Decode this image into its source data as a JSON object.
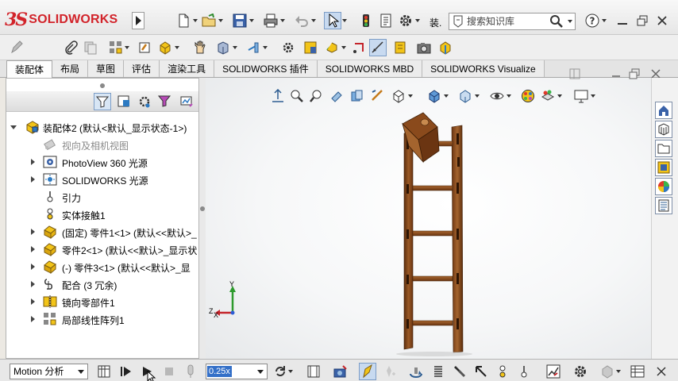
{
  "app": {
    "logo_mark": "3S",
    "logo_word": "SOLIDWORKS",
    "title_fragment": "装."
  },
  "search": {
    "placeholder": "搜索知识库"
  },
  "tabs": [
    {
      "label": "装配体",
      "active": true
    },
    {
      "label": "布局"
    },
    {
      "label": "草图"
    },
    {
      "label": "评估"
    },
    {
      "label": "渲染工具"
    },
    {
      "label": "SOLIDWORKS 插件"
    },
    {
      "label": "SOLIDWORKS MBD"
    },
    {
      "label": "SOLIDWORKS Visualize"
    }
  ],
  "tree": {
    "items": [
      {
        "label": "装配体2  (默认<默认_显示状态-1>)",
        "icon": "assembly-icon",
        "twisty": "open"
      },
      {
        "label": "视向及相机视图",
        "icon": "camera-icon",
        "twisty": "none",
        "grey": true
      },
      {
        "label": "PhotoView 360 光源",
        "icon": "photoview-icon",
        "twisty": "closed"
      },
      {
        "label": "SOLIDWORKS 光源",
        "icon": "lights-icon",
        "twisty": "closed"
      },
      {
        "label": "引力",
        "icon": "gravity-icon",
        "twisty": "none"
      },
      {
        "label": "实体接触1",
        "icon": "contact-icon",
        "twisty": "none"
      },
      {
        "label": "(固定) 零件1<1> (默认<<默认>_",
        "icon": "part-icon",
        "twisty": "closed"
      },
      {
        "label": "零件2<1> (默认<<默认>_显示状",
        "icon": "part-icon",
        "twisty": "closed"
      },
      {
        "label": "(-) 零件3<1> (默认<<默认>_显",
        "icon": "part-icon",
        "twisty": "closed"
      },
      {
        "label": "配合 (3 冗余)",
        "icon": "mates-icon",
        "twisty": "closed"
      },
      {
        "label": "镜向零部件1",
        "icon": "mirror-icon",
        "twisty": "closed"
      },
      {
        "label": "局部线性阵列1",
        "icon": "pattern-icon",
        "twisty": "closed"
      }
    ]
  },
  "motion": {
    "study_type": "Motion 分析",
    "playback_speed": "0.25x"
  },
  "triad": {
    "x": "X",
    "y": "Y",
    "z": "Z"
  },
  "colors": {
    "brand": "#d2232a",
    "wood": "#8a4a1c",
    "wood_dark": "#5a2c0c",
    "part_yellow": "#f2c418"
  }
}
